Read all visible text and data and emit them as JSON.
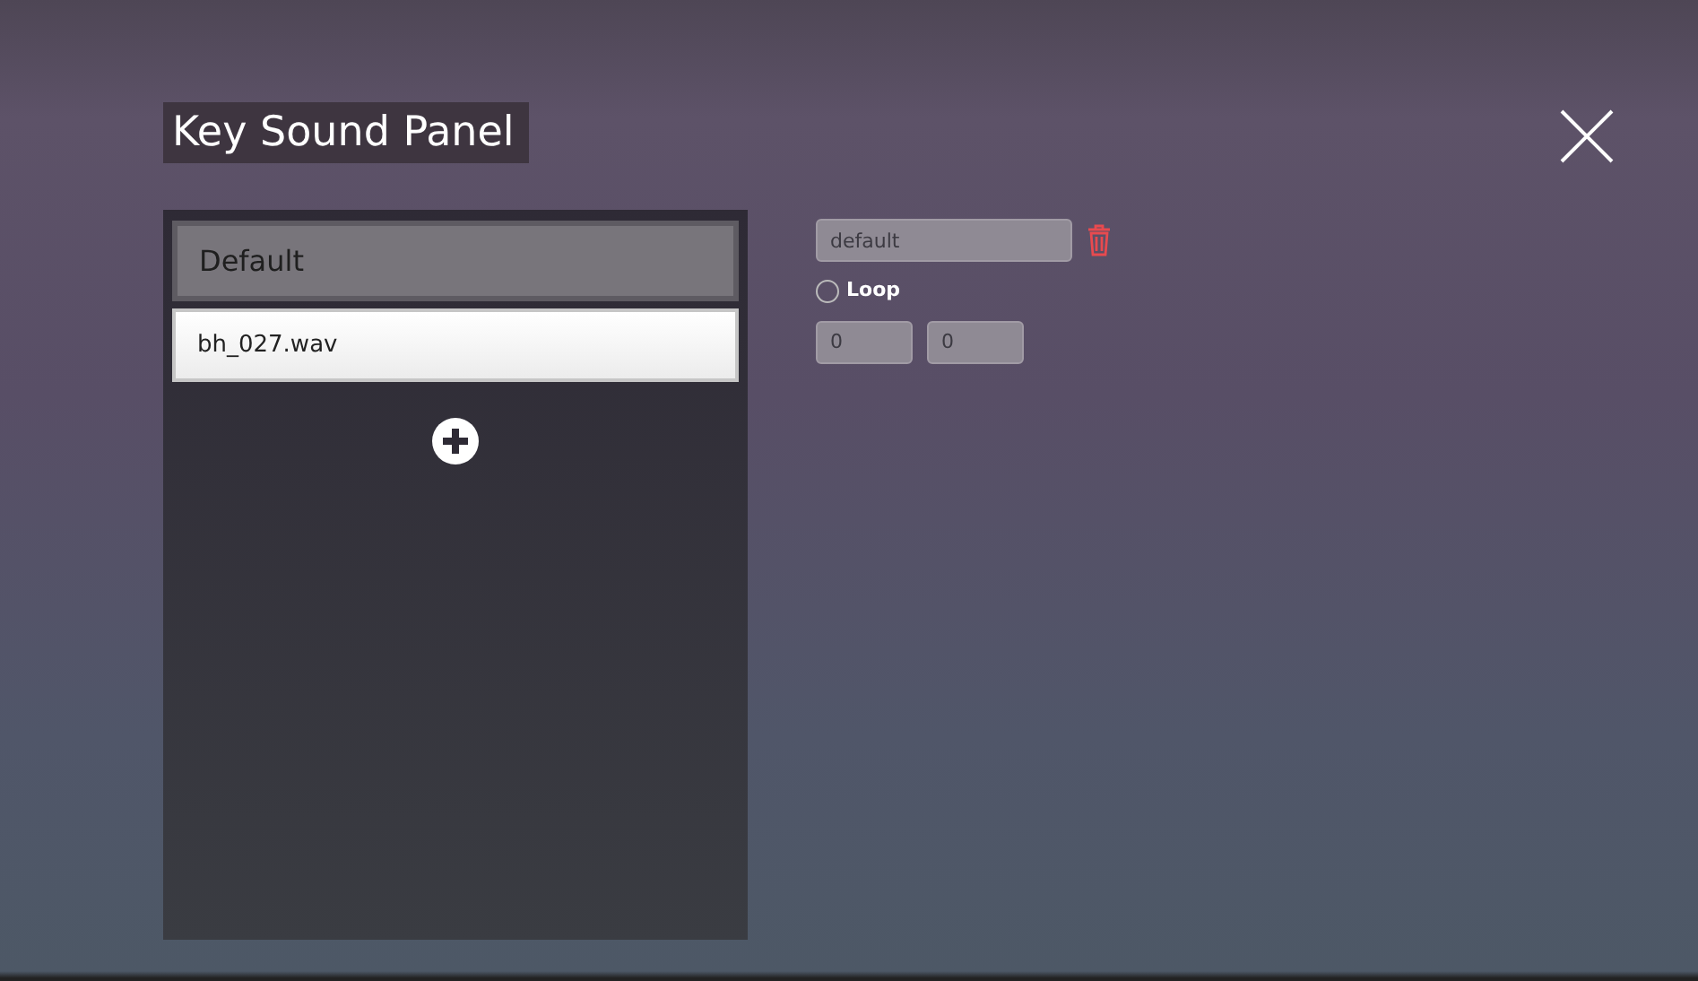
{
  "title": "Key Sound Panel",
  "sounds": [
    {
      "label": "Default",
      "selected": false
    },
    {
      "label": "bh_027.wav",
      "selected": true
    }
  ],
  "editor": {
    "name": "default",
    "loop": {
      "label": "Loop",
      "checked": false
    },
    "values": [
      "0",
      "0"
    ]
  }
}
